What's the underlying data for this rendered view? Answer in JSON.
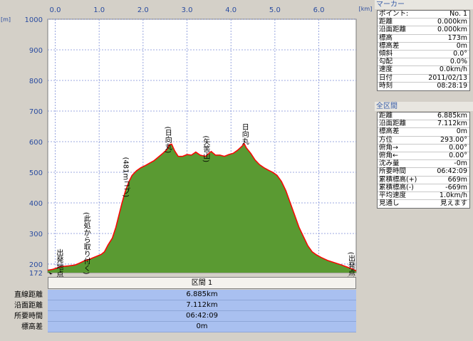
{
  "chart_data": {
    "type": "area",
    "xlabel_unit": "[km]",
    "ylabel_unit": "[m]",
    "xlim": [
      -0.17,
      6.85
    ],
    "ylim": [
      172,
      1000
    ],
    "x_ticks": [
      "0.0",
      "1.0",
      "2.0",
      "3.0",
      "4.0",
      "5.0",
      "6.0"
    ],
    "y_ticks": [
      "1000",
      "900",
      "800",
      "700",
      "600",
      "500",
      "400",
      "300",
      "200"
    ],
    "y_bottom_label": "172",
    "fill_color": "#5a9a32",
    "line_color": "#ff0000",
    "x": [
      -0.17,
      -0.05,
      0.05,
      0.15,
      0.3,
      0.45,
      0.55,
      0.65,
      0.75,
      0.85,
      0.95,
      1.05,
      1.12,
      1.2,
      1.3,
      1.38,
      1.45,
      1.52,
      1.6,
      1.68,
      1.75,
      1.85,
      1.95,
      2.05,
      2.15,
      2.25,
      2.35,
      2.45,
      2.55,
      2.6,
      2.65,
      2.72,
      2.8,
      2.9,
      3.0,
      3.1,
      3.2,
      3.3,
      3.42,
      3.55,
      3.65,
      3.75,
      3.85,
      3.95,
      4.05,
      4.15,
      4.25,
      4.3,
      4.35,
      4.45,
      4.55,
      4.65,
      4.75,
      4.85,
      4.95,
      5.05,
      5.15,
      5.25,
      5.35,
      5.45,
      5.55,
      5.65,
      5.75,
      5.85,
      5.95,
      6.05,
      6.2,
      6.35,
      6.5,
      6.65,
      6.78,
      6.85
    ],
    "y": [
      180,
      183,
      188,
      192,
      194,
      197,
      203,
      210,
      214,
      220,
      226,
      232,
      240,
      262,
      285,
      320,
      360,
      400,
      440,
      470,
      490,
      505,
      515,
      522,
      530,
      538,
      550,
      562,
      575,
      590,
      592,
      570,
      552,
      552,
      558,
      556,
      566,
      556,
      552,
      568,
      556,
      556,
      552,
      558,
      562,
      572,
      585,
      594,
      580,
      562,
      540,
      525,
      515,
      507,
      500,
      490,
      470,
      440,
      400,
      360,
      320,
      290,
      260,
      240,
      230,
      222,
      212,
      205,
      198,
      190,
      183,
      178
    ],
    "annotations": [
      {
        "text": "出発地点",
        "x": 0.08,
        "y": 250
      },
      {
        "text": "(此処から取り付く)",
        "x": 0.7,
        "y": 370
      },
      {
        "text": "(481mコブ)",
        "x": 1.6,
        "y": 550
      },
      {
        "text": "(日向丸)",
        "x": 2.55,
        "y": 650
      },
      {
        "text": "(矢筈山)",
        "x": 3.42,
        "y": 620
      },
      {
        "text": "日向丸",
        "x": 4.3,
        "y": 660
      },
      {
        "text": "(出発点)",
        "x": 6.72,
        "y": 240
      }
    ]
  },
  "section": {
    "header": "区間 1",
    "rows": [
      {
        "label": "直線距離",
        "value": "6.885km"
      },
      {
        "label": "沿面距離",
        "value": "7.112km"
      },
      {
        "label": "所要時間",
        "value": "06:42:09"
      },
      {
        "label": "標高差",
        "value": "0m"
      }
    ]
  },
  "marker_panel": {
    "title": "マーカー",
    "rows": [
      {
        "label": "ポイント:",
        "value": "No. 1"
      },
      {
        "label": "距離",
        "value": "0.000km"
      },
      {
        "label": "沿面距離",
        "value": "0.000km"
      },
      {
        "label": "標高",
        "value": "173m"
      },
      {
        "label": "標高差",
        "value": "0m"
      },
      {
        "label": "傾斜",
        "value": "0.0°"
      },
      {
        "label": "勾配",
        "value": "0.0%"
      },
      {
        "label": "速度",
        "value": "0.0km/h"
      },
      {
        "label": "日付",
        "value": "2011/02/13"
      },
      {
        "label": "時刻",
        "value": "08:28:19"
      }
    ]
  },
  "total_panel": {
    "title": "全区間",
    "rows": [
      {
        "label": "距離",
        "value": "6.885km"
      },
      {
        "label": "沿面距離",
        "value": "7.112km"
      },
      {
        "label": "標高差",
        "value": "0m"
      },
      {
        "label": "方位",
        "value": "293.00°"
      },
      {
        "label": "俯角→",
        "value": "0.00°"
      },
      {
        "label": "俯角←",
        "value": "0.00°"
      },
      {
        "label": "沈み量",
        "value": "-0m"
      },
      {
        "label": "所要時間",
        "value": "06:42:09"
      },
      {
        "label": "累積標高(+)",
        "value": "669m"
      },
      {
        "label": "累積標高(-)",
        "value": "-669m"
      },
      {
        "label": "平均速度",
        "value": "1.0km/h"
      },
      {
        "label": "見通し",
        "value": "見えます"
      }
    ]
  }
}
